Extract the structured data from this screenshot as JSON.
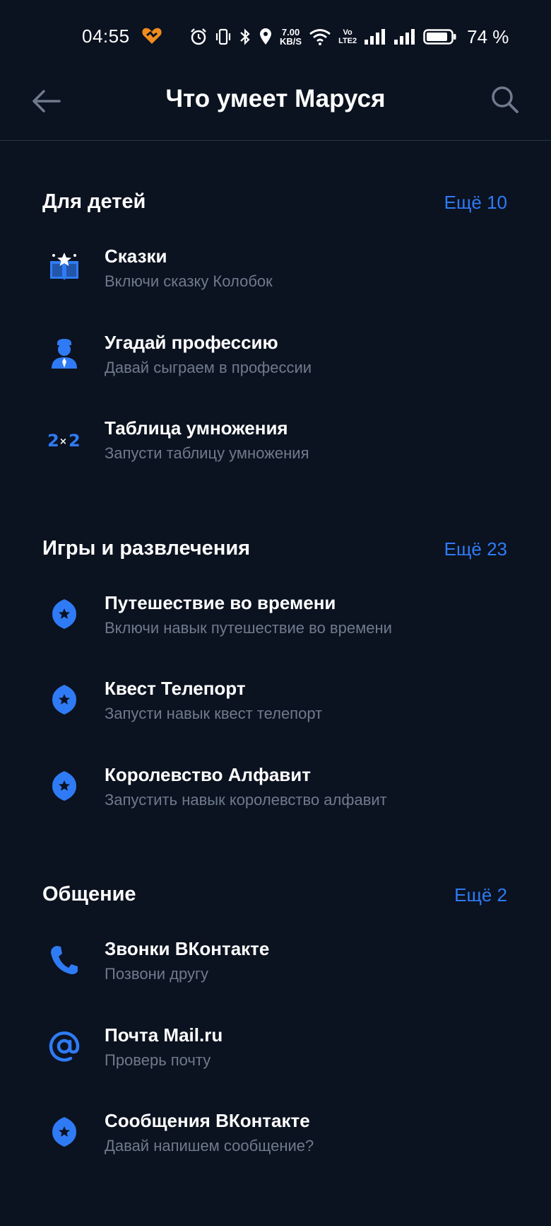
{
  "status_bar": {
    "time": "04:55",
    "net_speed_value": "7.00",
    "net_speed_unit": "KB/S",
    "volte_top": "Vo",
    "volte_bottom": "LTE2",
    "battery_percent": "74 %"
  },
  "header": {
    "title": "Что умеет Маруся",
    "back_icon": "arrow-left-icon",
    "search_icon": "search-icon"
  },
  "colors": {
    "background": "#0b1220",
    "accent": "#2f7bf5",
    "subtitle": "#6f7b8c"
  },
  "sections": [
    {
      "title": "Для детей",
      "more": "Ещё 10",
      "items": [
        {
          "title": "Сказки",
          "subtitle": "Включи сказку Колобок",
          "icon": "book-star-icon"
        },
        {
          "title": "Угадай профессию",
          "subtitle": "Давай сыграем в профессии",
          "icon": "person-icon"
        },
        {
          "title": "Таблица умножения",
          "subtitle": "Запусти таблицу умножения",
          "icon": "multiplication-icon"
        }
      ]
    },
    {
      "title": "Игры и развлечения",
      "more": "Ещё 23",
      "items": [
        {
          "title": "Путешествие во времени",
          "subtitle": "Включи навык путешествие во времени",
          "icon": "skill-star-icon"
        },
        {
          "title": "Квест Телепорт",
          "subtitle": "Запусти навык квест телепорт",
          "icon": "skill-star-icon"
        },
        {
          "title": "Королевство Алфавит",
          "subtitle": "Запустить навык королевство алфавит",
          "icon": "skill-star-icon"
        }
      ]
    },
    {
      "title": "Общение",
      "more": "Ещё 2",
      "items": [
        {
          "title": "Звонки ВКонтакте",
          "subtitle": "Позвони другу",
          "icon": "phone-icon"
        },
        {
          "title": "Почта Mail.ru",
          "subtitle": "Проверь почту",
          "icon": "at-sign-icon"
        },
        {
          "title": "Сообщения ВКонтакте",
          "subtitle": "Давай напишем сообщение?",
          "icon": "skill-star-icon"
        }
      ]
    }
  ]
}
